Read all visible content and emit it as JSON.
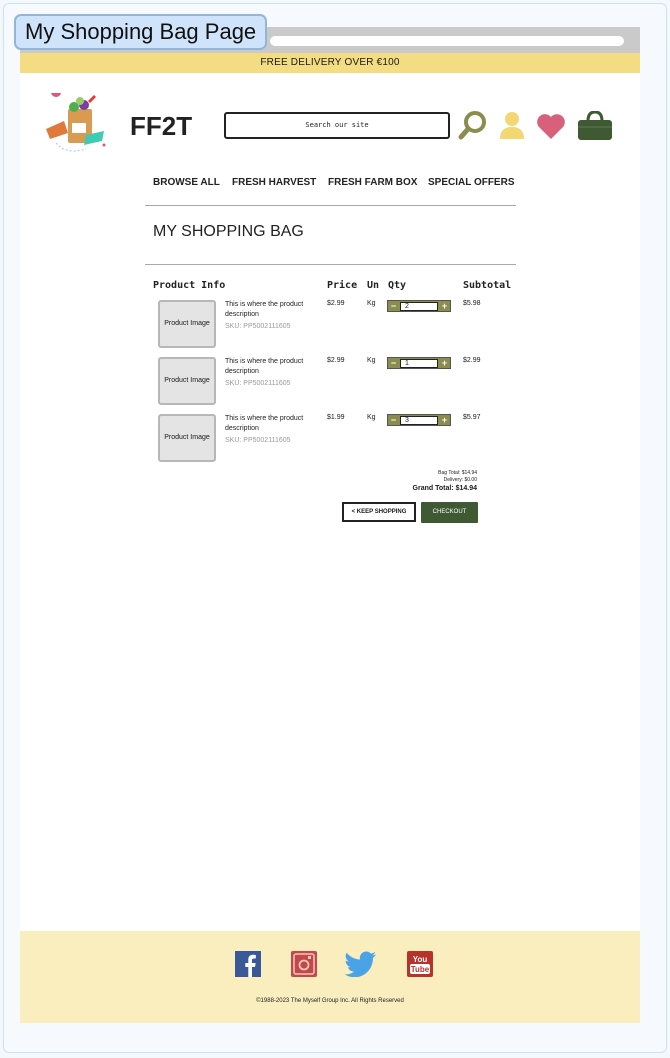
{
  "screen_label": "My Shopping Bag Page",
  "promo": "FREE DELIVERY OVER €100",
  "brand": "FF2T",
  "search": {
    "placeholder": "Search our site"
  },
  "nav": [
    "BROWSE ALL",
    "FRESH HARVEST",
    "FRESH FARM BOX",
    "SPECIAL OFFERS"
  ],
  "bag_title": "MY SHOPPING BAG",
  "table_headers": {
    "product": "Product Info",
    "price": "Price",
    "unit": "Un",
    "qty": "Qty",
    "subtotal": "Subtotal"
  },
  "items": [
    {
      "image_label": "Product Image",
      "description": "This is where the product description",
      "sku": "SKU: PP5002111605",
      "price": "$2.99",
      "unit": "Kg",
      "qty": "2",
      "subtotal": "$5.98"
    },
    {
      "image_label": "Product Image",
      "description": "This is where the product description",
      "sku": "SKU: PP5002111605",
      "price": "$2.99",
      "unit": "Kg",
      "qty": "1",
      "subtotal": "$2.99"
    },
    {
      "image_label": "Product Image",
      "description": "This is where the product description",
      "sku": "SKU: PP5002111605",
      "price": "$1.99",
      "unit": "Kg",
      "qty": "3",
      "subtotal": "$5.97"
    }
  ],
  "qty_symbols": {
    "minus": "−",
    "plus": "+"
  },
  "totals": {
    "bag_total": "Bag Total: $14.94",
    "delivery": "Delivery: $0.00",
    "grand_total": "Grand Total: $14.94"
  },
  "buttons": {
    "keep_shopping": "< KEEP SHOPPING",
    "checkout": "CHECKOUT"
  },
  "footer": {
    "copyright": "©1988-2023 The Myself Group Inc. All Rights Reserved"
  },
  "icons": [
    "search-icon",
    "user-icon",
    "heart-icon",
    "bag-icon",
    "facebook-icon",
    "instagram-icon",
    "twitter-icon",
    "youtube-icon"
  ],
  "colors": {
    "promo_bg": "#f3dc82",
    "footer_bg": "#faedbe",
    "accent_olive": "#8b8d4e",
    "checkout_green": "#3f5a33",
    "heart_pink": "#d9607a",
    "user_yellow": "#f2d772"
  }
}
